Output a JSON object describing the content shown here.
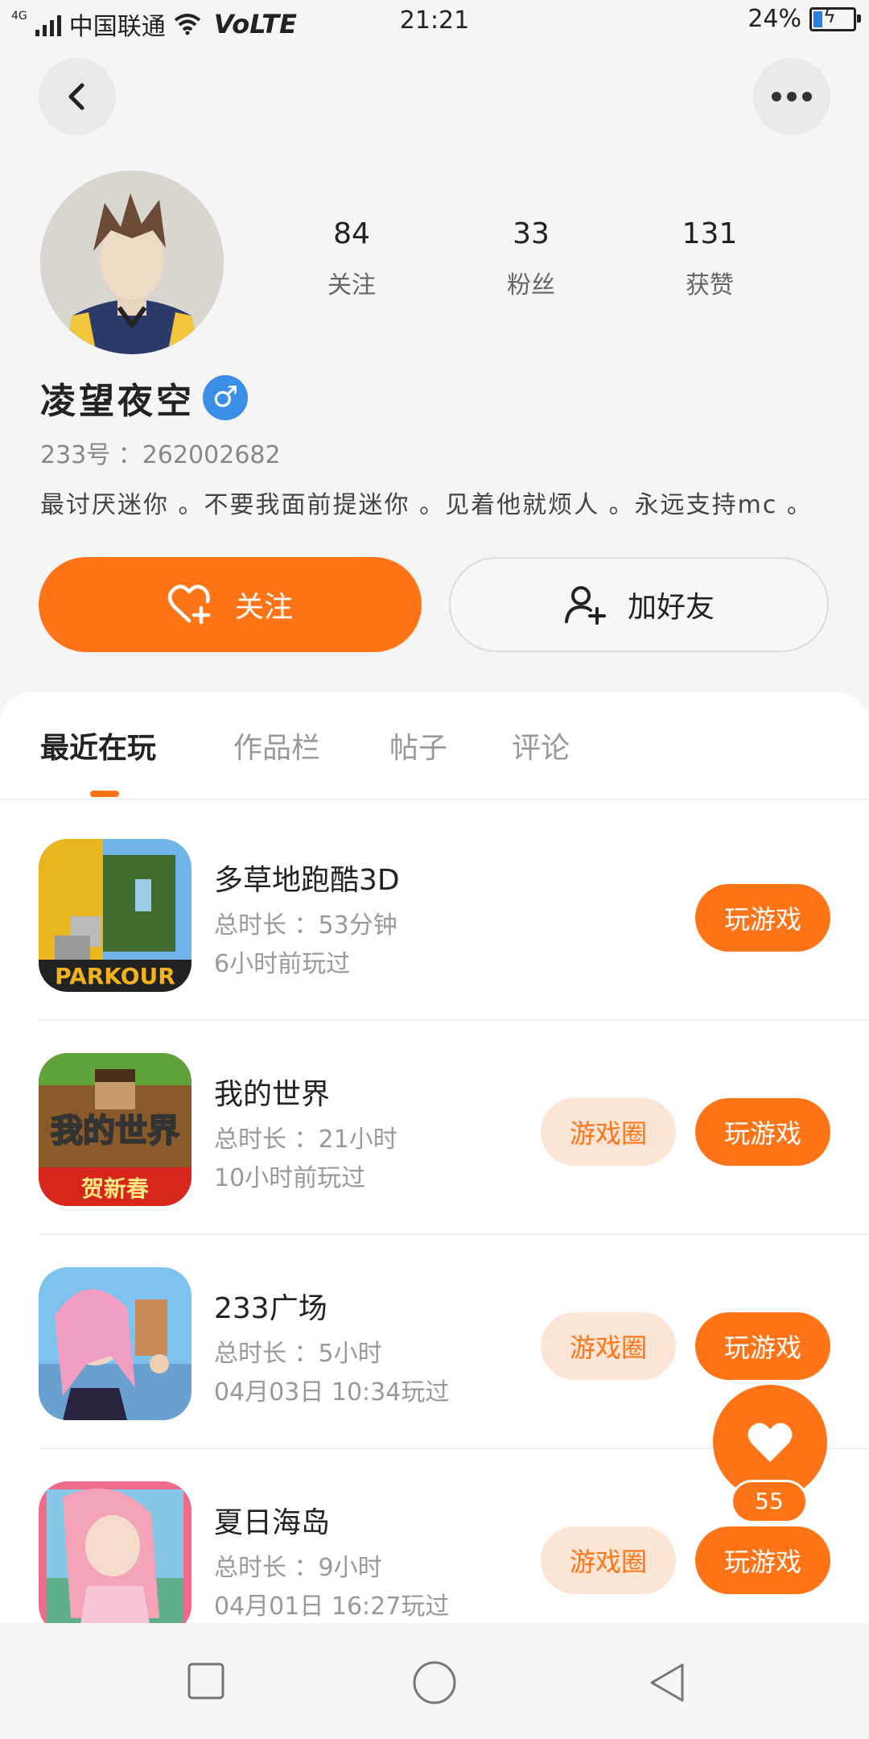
{
  "status_bar": {
    "network_tag": "4G",
    "carrier": "中国联通",
    "volte": "VoLTE",
    "time": "21:21",
    "battery": "24%",
    "battery_level": 0.24
  },
  "nav": {
    "back_icon": "chevron-left-icon",
    "more_icon": "more-horizontal-icon"
  },
  "profile": {
    "stats": [
      {
        "value": "84",
        "label": "关注"
      },
      {
        "value": "33",
        "label": "粉丝"
      },
      {
        "value": "131",
        "label": "获赞"
      }
    ],
    "username": "凌望夜空",
    "gender_symbol": "♂",
    "user_id": "233号 ：262002682",
    "bio": "最讨厌迷你 。不要我面前提迷你 。见着他就烦人 。永远支持mc 。",
    "follow_label": "关注",
    "add_friend_label": "加好友"
  },
  "tabs": [
    {
      "label": "最近在玩",
      "active": true
    },
    {
      "label": "作品栏",
      "active": false
    },
    {
      "label": "帖子",
      "active": false
    },
    {
      "label": "评论",
      "active": false
    }
  ],
  "games": [
    {
      "name": "多草地跑酷3D",
      "duration": "总时长 ：53分钟",
      "last_played": "6小时前玩过",
      "icon_text": "PARKOUR",
      "circle_label": null,
      "play_label": "玩游戏"
    },
    {
      "name": "我的世界",
      "duration": "总时长 ：21小时",
      "last_played": "10小时前玩过",
      "icon_text": "我的世界",
      "icon_subtext": "贺新春",
      "circle_label": "游戏圈",
      "play_label": "玩游戏"
    },
    {
      "name": "233广场",
      "duration": "总时长 ：5小时",
      "last_played": "04月03日 10:34玩过",
      "circle_label": "游戏圈",
      "play_label": "玩游戏"
    },
    {
      "name": "夏日海岛",
      "duration": "总时长 ：9小时",
      "last_played": "04月01日 16:27玩过",
      "circle_label": "游戏圈",
      "play_label": "玩游戏"
    }
  ],
  "like_fab": {
    "count": "55"
  },
  "colors": {
    "accent": "#ff7417",
    "accent_light": "#fde5d6",
    "badge_blue": "#3a8ee6"
  }
}
